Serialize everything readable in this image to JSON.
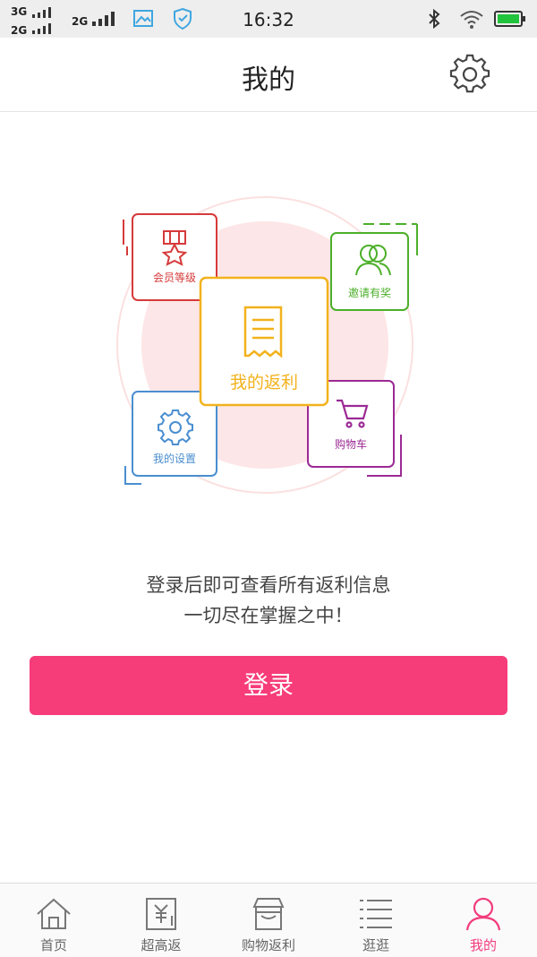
{
  "status_bar": {
    "signal1": "3G",
    "signal2": "2G",
    "signal3": "2G",
    "time": "16:32"
  },
  "header": {
    "title": "我的",
    "settings_icon": "gear-icon"
  },
  "illustration": {
    "center_label": "我的返利",
    "cards": {
      "member": "会员等级",
      "invite": "邀请有奖",
      "settings": "我的设置",
      "cart": "购物车"
    },
    "colors": {
      "member": "#d63a3a",
      "invite": "#4caf2a",
      "settings": "#4a8ed0",
      "cart": "#9b2a94",
      "center": "#f2b21c"
    }
  },
  "info": {
    "line1": "登录后即可查看所有返利信息",
    "line2": "一切尽在掌握之中！"
  },
  "login_button": "登录",
  "accent": "#f73c7a",
  "tabs": [
    {
      "label": "首页",
      "icon": "home-icon"
    },
    {
      "label": "超高返",
      "icon": "yen-card-icon"
    },
    {
      "label": "购物返利",
      "icon": "shop-icon"
    },
    {
      "label": "逛逛",
      "icon": "list-icon"
    },
    {
      "label": "我的",
      "icon": "person-icon",
      "active": true
    }
  ]
}
